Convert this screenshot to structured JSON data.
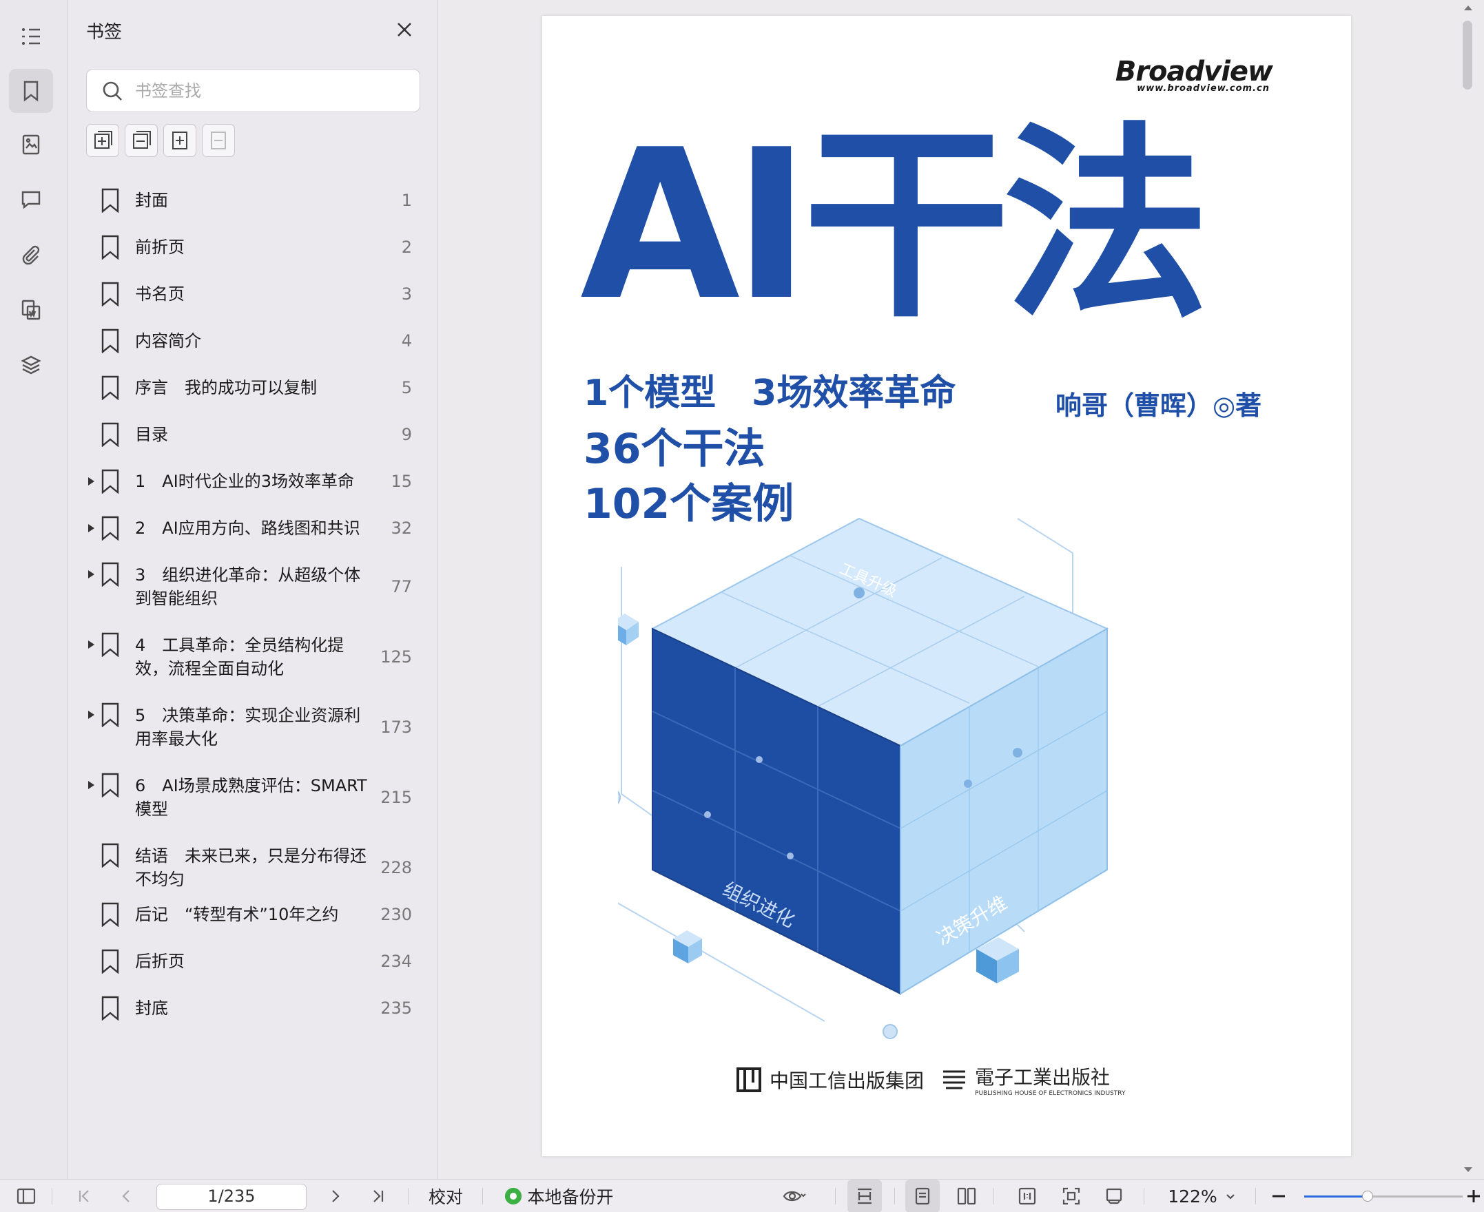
{
  "panel": {
    "title": "书签",
    "search_placeholder": "书签查找",
    "bookmarks": [
      {
        "label": "封面",
        "page": "1",
        "expandable": false
      },
      {
        "label": "前折页",
        "page": "2",
        "expandable": false
      },
      {
        "label": "书名页",
        "page": "3",
        "expandable": false
      },
      {
        "label": "内容简介",
        "page": "4",
        "expandable": false
      },
      {
        "label": "序言　我的成功可以复制",
        "page": "5",
        "expandable": false
      },
      {
        "label": "目录",
        "page": "9",
        "expandable": false
      },
      {
        "label": "1　AI时代企业的3场效率革命",
        "page": "15",
        "expandable": true
      },
      {
        "label": "2　AI应用方向、路线图和共识",
        "page": "32",
        "expandable": true
      },
      {
        "label": "3　组织进化革命：从超级个体到智能组织",
        "page": "77",
        "expandable": true
      },
      {
        "label": "4　工具革命：全员结构化提效，流程全面自动化",
        "page": "125",
        "expandable": true
      },
      {
        "label": "5　决策革命：实现企业资源利用率最大化",
        "page": "173",
        "expandable": true
      },
      {
        "label": "6　AI场景成熟度评估：SMART模型",
        "page": "215",
        "expandable": true
      },
      {
        "label": "结语　未来已来，只是分布得还不均匀",
        "page": "228",
        "expandable": false
      },
      {
        "label": "后记　“转型有术”10年之约",
        "page": "230",
        "expandable": false
      },
      {
        "label": "后折页",
        "page": "234",
        "expandable": false
      },
      {
        "label": "封底",
        "page": "235",
        "expandable": false
      }
    ]
  },
  "cover": {
    "brand": "Broadview",
    "brand_url": "www.broadview.com.cn",
    "title": "AI干法",
    "subtitle_1": "1个模型　3场效率革命",
    "subtitle_2": "36个干法",
    "subtitle_3": "102个案例",
    "author": "响哥（曹晖）◎著",
    "cube_label_top": "工具升级",
    "cube_label_left": "组织进化",
    "cube_label_right": "决策升维",
    "publisher_1": "中国工信出版集团",
    "publisher_2": "電子工業出版社",
    "publisher_2_en": "PUBLISHING HOUSE OF ELECTRONICS INDUSTRY"
  },
  "statusbar": {
    "page_indicator": "1/235",
    "proofread": "校对",
    "backup": "本地备份开",
    "zoom": "122%",
    "zoom_slider_fraction": 0.33
  },
  "colors": {
    "title_blue": "#1f4fa6",
    "backup_green": "#3cb043"
  }
}
